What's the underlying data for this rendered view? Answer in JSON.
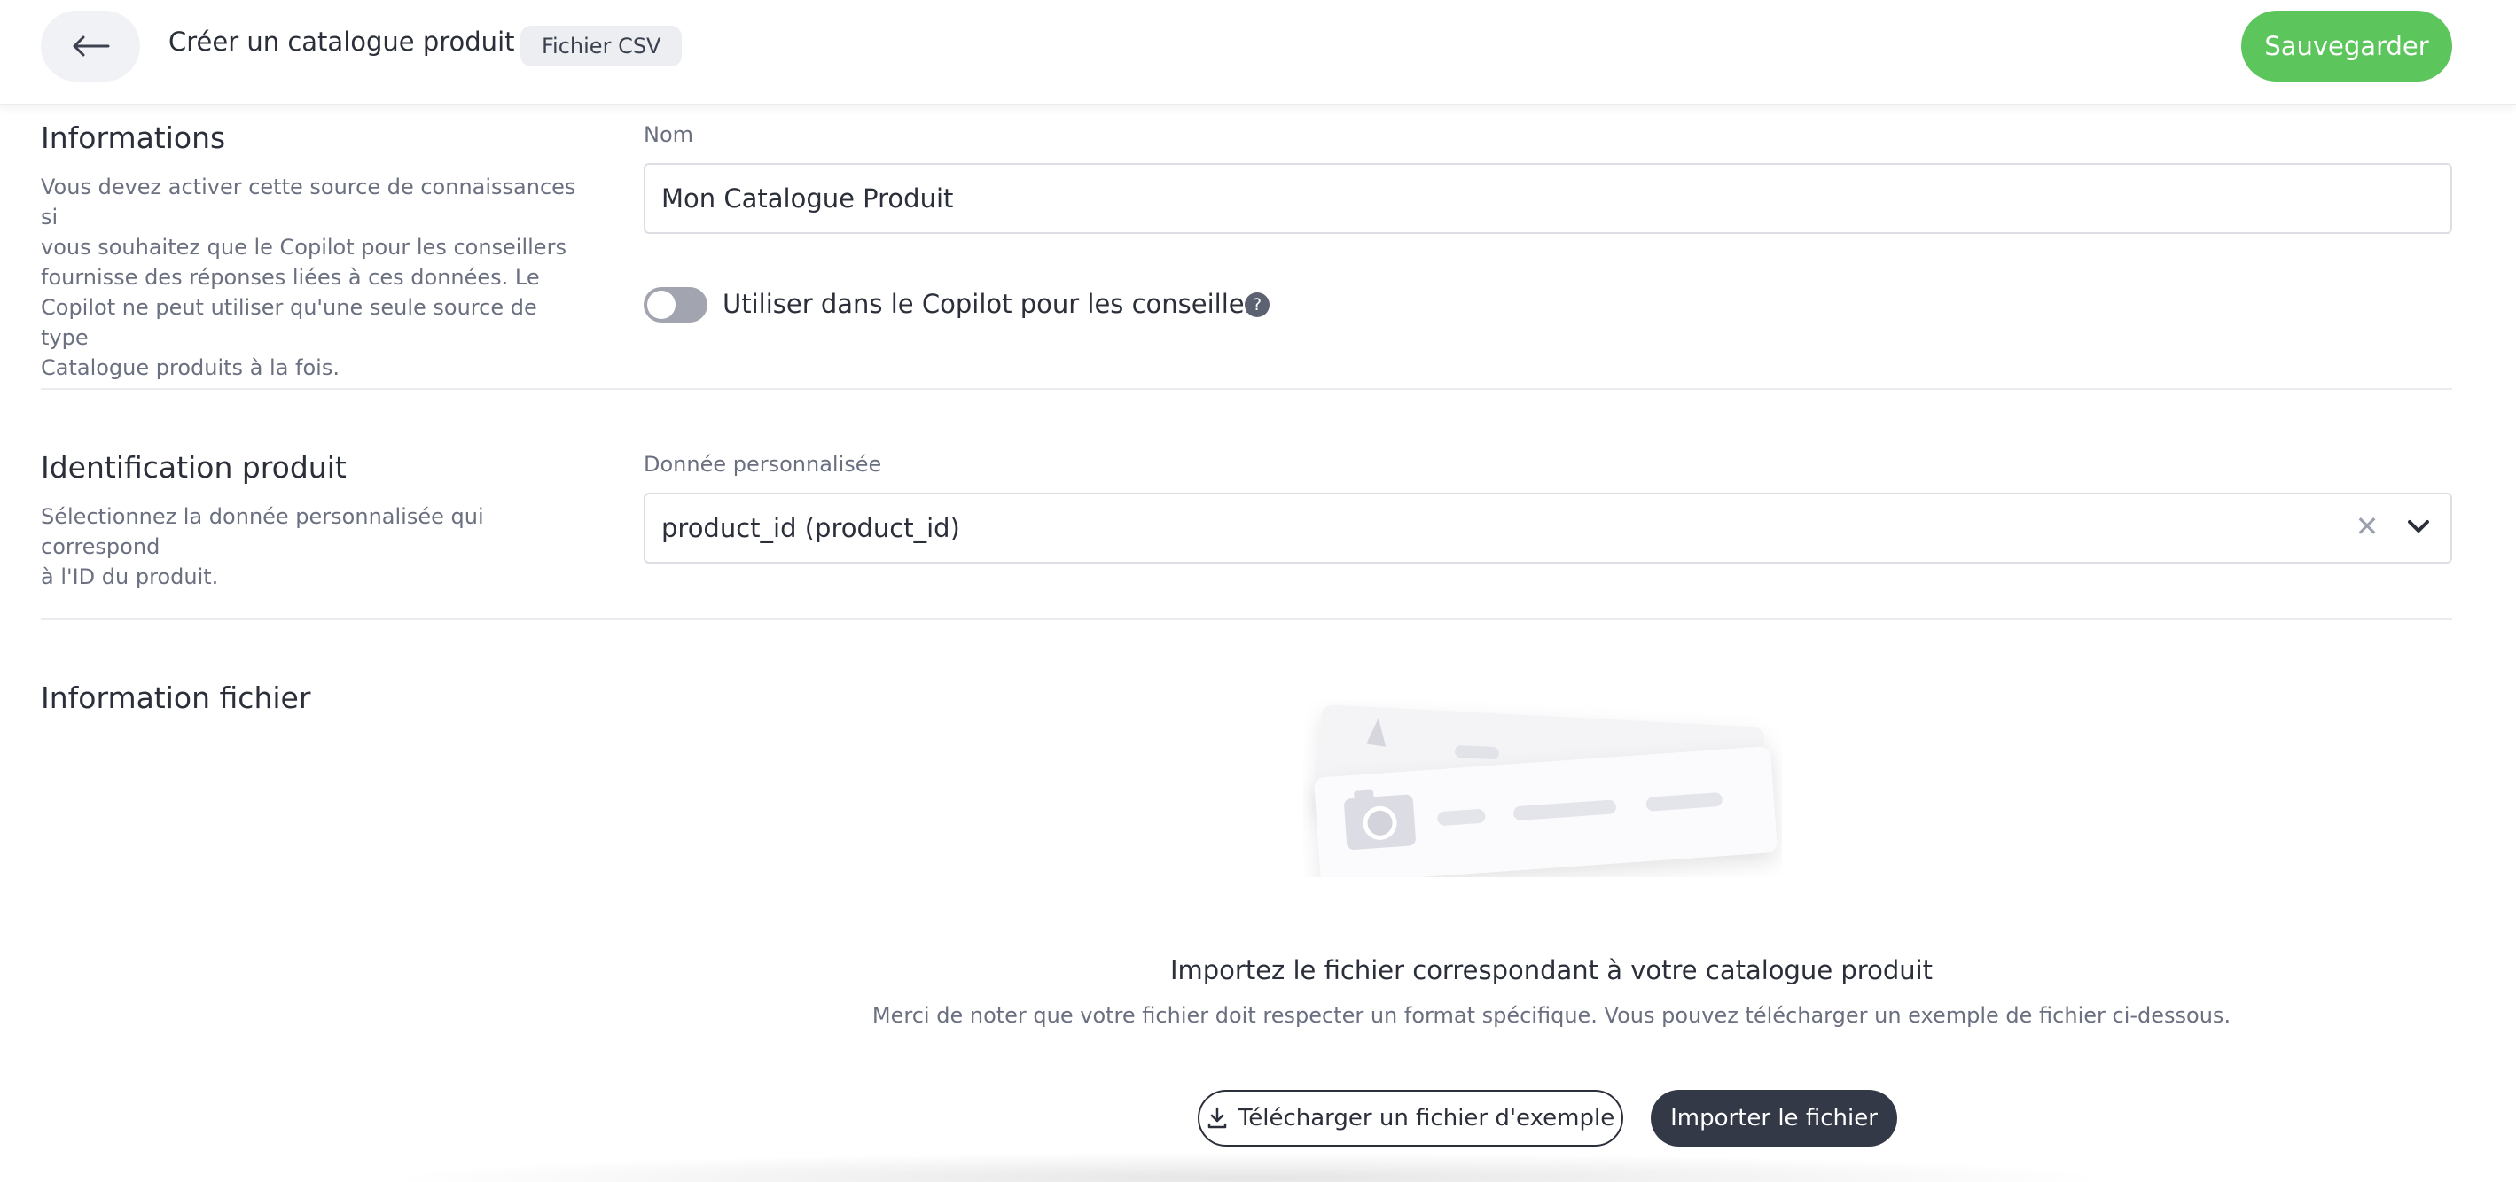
{
  "header": {
    "title": "Créer un catalogue produit",
    "chip": "Fichier CSV",
    "save_label": "Sauvegarder"
  },
  "informations": {
    "title": "Informations",
    "description_lines": [
      "Vous devez activer cette source de connaissances si",
      "vous souhaitez que le Copilot pour les conseillers",
      "fournisse des réponses liées à ces données. Le",
      "Copilot ne peut utiliser qu'une seule source de type",
      "Catalogue produits à la fois."
    ],
    "name_label": "Nom",
    "name_value": "Mon Catalogue Produit",
    "toggle_label": "Utiliser dans le Copilot pour les conseillers",
    "toggle_on": false,
    "help_glyph": "?"
  },
  "identification": {
    "title": "Identification produit",
    "description_lines": [
      "Sélectionnez la donnée personnalisée qui correspond",
      "à l'ID du produit."
    ],
    "field_label": "Donnée personnalisée",
    "selected_value": "product_id (product_id)"
  },
  "fichier": {
    "title": "Information fichier",
    "upload_title": "Importez le fichier correspondant à votre catalogue produit",
    "upload_description": "Merci de noter que votre fichier doit respecter un format spécifique. Vous pouvez télécharger un exemple de fichier ci-dessous.",
    "download_label": "Télécharger un fichier d'exemple",
    "import_label": "Importer le fichier"
  },
  "colors": {
    "save_green": "#5cc55c",
    "dark_button": "#343947",
    "toggle_off": "#a2a5af"
  },
  "icons": {
    "back": "arrow-left-icon",
    "clear": "close-icon",
    "chevron": "chevron-down-icon",
    "download": "download-icon",
    "help": "question-icon"
  }
}
